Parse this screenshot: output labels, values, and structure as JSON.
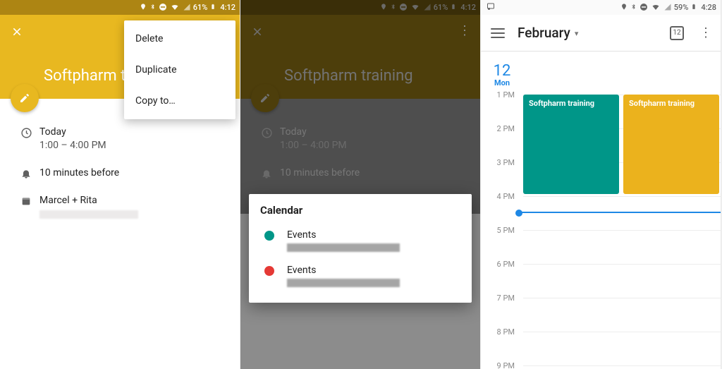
{
  "status": {
    "battery_a": "61%",
    "time_a": "4:12",
    "battery_c": "59%",
    "time_c": "4:28"
  },
  "event": {
    "title": "Softpharm training",
    "title_truncated": "Softpharm tra",
    "date_label": "Today",
    "time_range": "1:00 – 4:00 PM",
    "reminder": "10 minutes before",
    "calendar": "Marcel + Rita"
  },
  "menu": {
    "delete": "Delete",
    "duplicate": "Duplicate",
    "copy_to": "Copy to…"
  },
  "picker": {
    "title": "Calendar",
    "options": [
      {
        "label": "Events",
        "color": "#009688"
      },
      {
        "label": "Events",
        "color": "#e53935"
      }
    ]
  },
  "dayview": {
    "month": "February",
    "today_icon_date": "12",
    "day_num": "12",
    "day_dow": "Mon",
    "hour_spacing_px": 48,
    "hours": [
      "1 PM",
      "2 PM",
      "3 PM",
      "4 PM",
      "5 PM",
      "6 PM",
      "7 PM",
      "8 PM",
      "9 PM"
    ],
    "now_index": 3.45,
    "events": [
      {
        "label": "Softpharm training",
        "color": "teal",
        "start_index": 0,
        "end_index": 3,
        "col": 0,
        "cols": 2
      },
      {
        "label": "Softpharm training",
        "color": "yellow",
        "start_index": 0,
        "end_index": 3,
        "col": 1,
        "cols": 2
      }
    ]
  }
}
